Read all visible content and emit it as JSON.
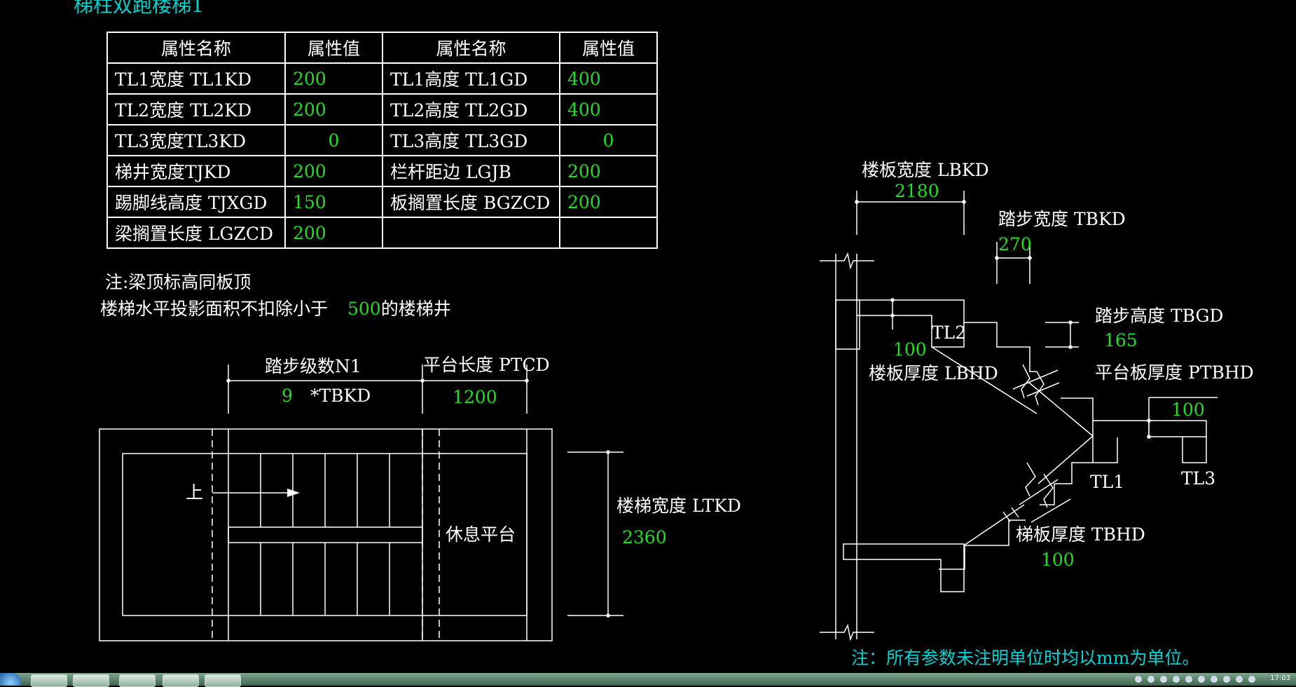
{
  "title": "梯柱双跑楼梯1",
  "table": {
    "headers": [
      "属性名称",
      "属性值",
      "属性名称",
      "属性值"
    ],
    "rows": [
      [
        "TL1宽度 TL1KD",
        "200",
        "TL1高度 TL1GD",
        "400"
      ],
      [
        "TL2宽度 TL2KD",
        "200",
        "TL2高度 TL2GD",
        "400"
      ],
      [
        "TL3宽度TL3KD",
        "0",
        "TL3高度 TL3GD",
        "0"
      ],
      [
        "梯井宽度TJKD",
        "200",
        "栏杆距边 LGJB",
        "200"
      ],
      [
        "踢脚线高度 TJXGD",
        "150",
        "板搁置长度 BGZCD",
        "200"
      ],
      [
        "梁搁置长度 LGZCD",
        "200",
        "",
        ""
      ]
    ]
  },
  "notes": {
    "line1": "注:梁顶标高同板顶",
    "line2_prefix": "楼梯水平投影面积不扣除小于",
    "line2_value": "500",
    "line2_suffix": "的楼梯井",
    "bottom": "注：所有参数未注明单位时均以mm为单位。"
  },
  "plan": {
    "steps_label": "踏步级数N1",
    "steps_value": "9",
    "steps_unit": "*TBKD",
    "platform_label": "平台长度 PTCD",
    "platform_value": "1200",
    "up_label": "上",
    "rest_label": "休息平台",
    "width_label": "楼梯宽度 LTKD",
    "width_value": "2360"
  },
  "section": {
    "slab_width_label": "楼板宽度 LBKD",
    "slab_width_value": "2180",
    "tread_width_label": "踏步宽度 TBKD",
    "tread_width_value": "270",
    "tread_height_label": "踏步高度 TBGD",
    "tread_height_value": "165",
    "slab_thick_label": "楼板厚度 LBHD",
    "slab_thick_value": "100",
    "tl2_label": "TL2",
    "platform_thick_label": "平台板厚度 PTBHD",
    "platform_thick_value": "100",
    "tl1_label": "TL1",
    "tl3_label": "TL3",
    "stair_thick_label": "梯板厚度 TBHD",
    "stair_thick_value": "100"
  },
  "taskbar": {
    "clock": "17:03"
  },
  "colors": {
    "background": "#000000",
    "lines": "#ffffff",
    "values": "#1ee01e",
    "note_accent": "#00d2d2"
  }
}
